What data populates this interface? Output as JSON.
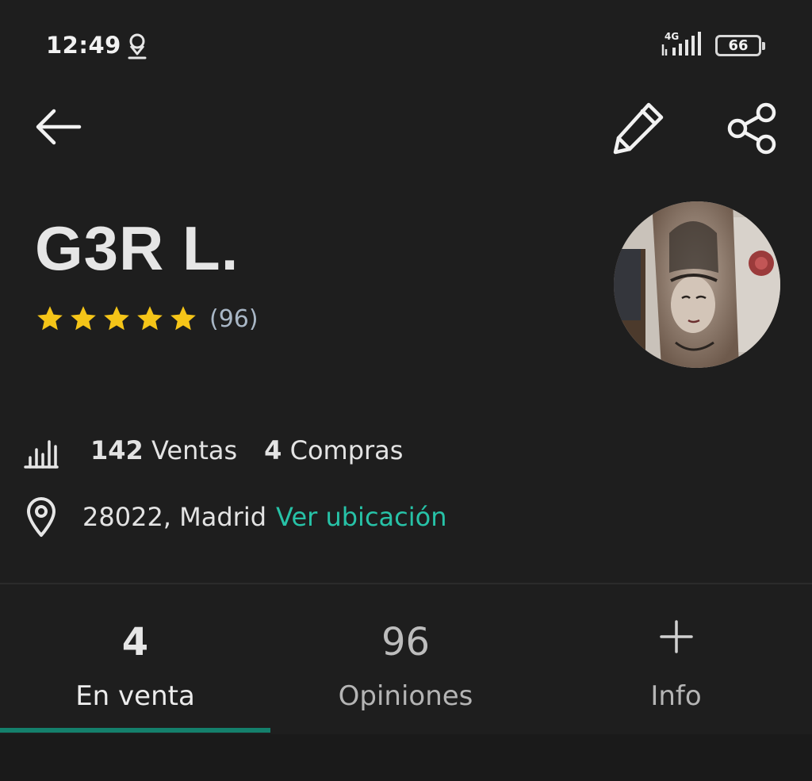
{
  "status_bar": {
    "time": "12:49",
    "network": "4G",
    "battery": "66"
  },
  "header": {
    "back_icon": "arrow-left-icon",
    "edit_icon": "pencil-icon",
    "share_icon": "share-icon"
  },
  "profile": {
    "name": "G3R L.",
    "rating_stars": 5,
    "review_count": "(96)",
    "star_color": "#f5c518",
    "avatar": "tattoo-photo"
  },
  "stats": {
    "sales_count": "142",
    "sales_label": "Ventas",
    "purchases_count": "4",
    "purchases_label": "Compras"
  },
  "location": {
    "text": "28022, Madrid",
    "link": "Ver ubicación",
    "link_color": "#27c2a7"
  },
  "tabs": [
    {
      "count": "4",
      "label": "En venta",
      "active": true
    },
    {
      "count": "96",
      "label": "Opiniones",
      "active": false
    },
    {
      "count": "+",
      "label": "Info",
      "active": false
    }
  ],
  "accent": "#14806c"
}
